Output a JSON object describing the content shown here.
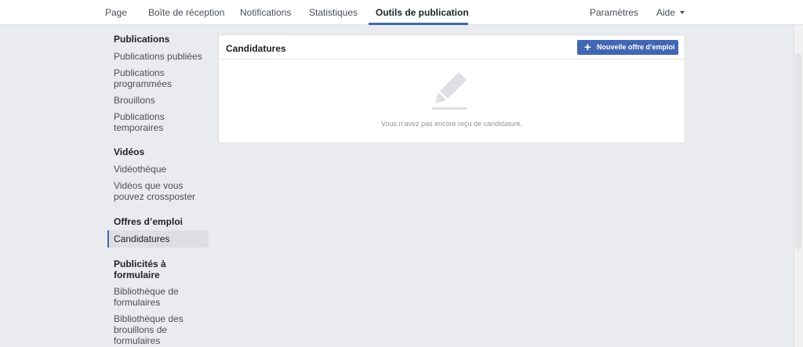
{
  "topnav": {
    "items": [
      {
        "label": "Page"
      },
      {
        "label": "Boîte de réception"
      },
      {
        "label": "Notifications"
      },
      {
        "label": "Statistiques"
      },
      {
        "label": "Outils de publication"
      }
    ],
    "active_index": 4,
    "settings_label": "Paramètres",
    "help_label": "Aide"
  },
  "sidebar": {
    "section_publications": "Publications",
    "published": "Publications publiées",
    "scheduled": "Publications programmées",
    "drafts": "Brouillons",
    "temporary": "Publications temporaires",
    "section_videos": "Vidéos",
    "video_library": "Vidéothèque",
    "crosspost": "Vidéos que vous pouvez crossposter",
    "section_jobs": "Offres d’emploi",
    "applications": "Candidatures",
    "section_lead_ads": "Publicités à formulaire",
    "forms_library": "Bibliothèque de formulaires",
    "draft_forms_library": "Bibliothèque des brouillons de formulaires"
  },
  "panel": {
    "title": "Candidatures",
    "new_job_button": "Nouvelle offre d’emploi",
    "empty_message": "Vous n’avez pas encore reçu de candidature.",
    "empty_icon": "pencil-icon"
  },
  "colors": {
    "accent": "#4267b2",
    "background": "#e9ebee"
  }
}
